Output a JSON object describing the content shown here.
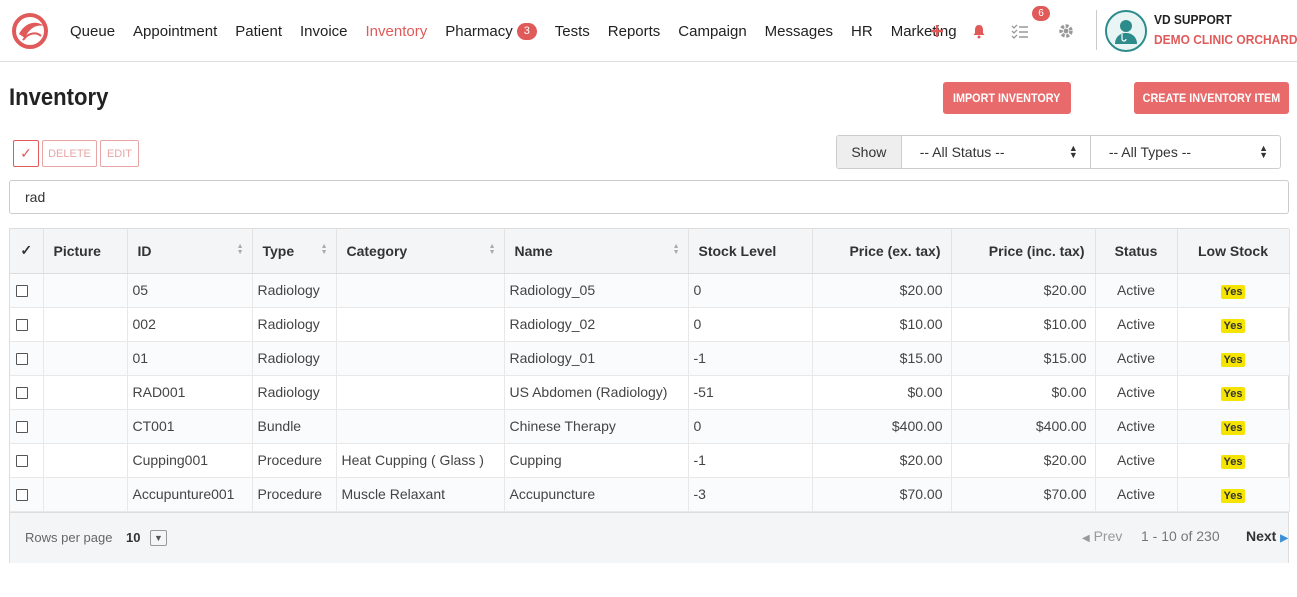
{
  "nav": {
    "items": [
      {
        "label": "Queue"
      },
      {
        "label": "Appointment"
      },
      {
        "label": "Patient"
      },
      {
        "label": "Invoice"
      },
      {
        "label": "Inventory",
        "active": true
      },
      {
        "label": "Pharmacy",
        "badge": "3"
      },
      {
        "label": "Tests"
      },
      {
        "label": "Reports"
      },
      {
        "label": "Campaign"
      },
      {
        "label": "Messages"
      },
      {
        "label": "HR"
      },
      {
        "label": "Marketing"
      }
    ],
    "tasks_badge": "6",
    "icons": [
      "plus-icon",
      "bell-icon",
      "tasks-icon",
      "gear-icon"
    ],
    "accent": "#e05a5a"
  },
  "user": {
    "name": "VD SUPPORT",
    "clinic": "DEMO CLINIC ORCHARD"
  },
  "page": {
    "title": "Inventory",
    "import_label": "IMPORT INVENTORY",
    "create_label": "CREATE INVENTORY ITEM"
  },
  "toolbar": {
    "check_label": "✓",
    "delete_label": "DELETE",
    "edit_label": "EDIT",
    "show_label": "Show",
    "status_filter": "-- All Status --",
    "type_filter": "-- All Types --"
  },
  "search": {
    "value": "rad"
  },
  "table": {
    "columns": [
      "✓",
      "Picture",
      "ID",
      "Type",
      "Category",
      "Name",
      "Stock Level",
      "Price (ex. tax)",
      "Price (inc. tax)",
      "Status",
      "Low Stock"
    ],
    "rows": [
      {
        "id": "05",
        "type": "Radiology",
        "category": "",
        "name": "Radiology_05",
        "stock": "0",
        "price_ex": "$20.00",
        "price_inc": "$20.00",
        "status": "Active",
        "low": "Yes"
      },
      {
        "id": "002",
        "type": "Radiology",
        "category": "",
        "name": "Radiology_02",
        "stock": "0",
        "price_ex": "$10.00",
        "price_inc": "$10.00",
        "status": "Active",
        "low": "Yes"
      },
      {
        "id": "01",
        "type": "Radiology",
        "category": "",
        "name": "Radiology_01",
        "stock": "-1",
        "price_ex": "$15.00",
        "price_inc": "$15.00",
        "status": "Active",
        "low": "Yes"
      },
      {
        "id": "RAD001",
        "type": "Radiology",
        "category": "",
        "name": "US Abdomen (Radiology)",
        "stock": "-51",
        "price_ex": "$0.00",
        "price_inc": "$0.00",
        "status": "Active",
        "low": "Yes"
      },
      {
        "id": "CT001",
        "type": "Bundle",
        "category": "",
        "name": "Chinese Therapy",
        "stock": "0",
        "price_ex": "$400.00",
        "price_inc": "$400.00",
        "status": "Active",
        "low": "Yes"
      },
      {
        "id": "Cupping001",
        "type": "Procedure",
        "category": "Heat Cupping ( Glass )",
        "name": "Cupping",
        "stock": "-1",
        "price_ex": "$20.00",
        "price_inc": "$20.00",
        "status": "Active",
        "low": "Yes"
      },
      {
        "id": "Accupunture001",
        "type": "Procedure",
        "category": "Muscle Relaxant",
        "name": "Accupuncture",
        "stock": "-3",
        "price_ex": "$70.00",
        "price_inc": "$70.00",
        "status": "Active",
        "low": "Yes"
      }
    ]
  },
  "pagination": {
    "rows_per_page_label": "Rows per page",
    "rows_per_page": "10",
    "prev_label": "Prev",
    "range": "1 - 10 of 230",
    "next_label": "Next"
  }
}
